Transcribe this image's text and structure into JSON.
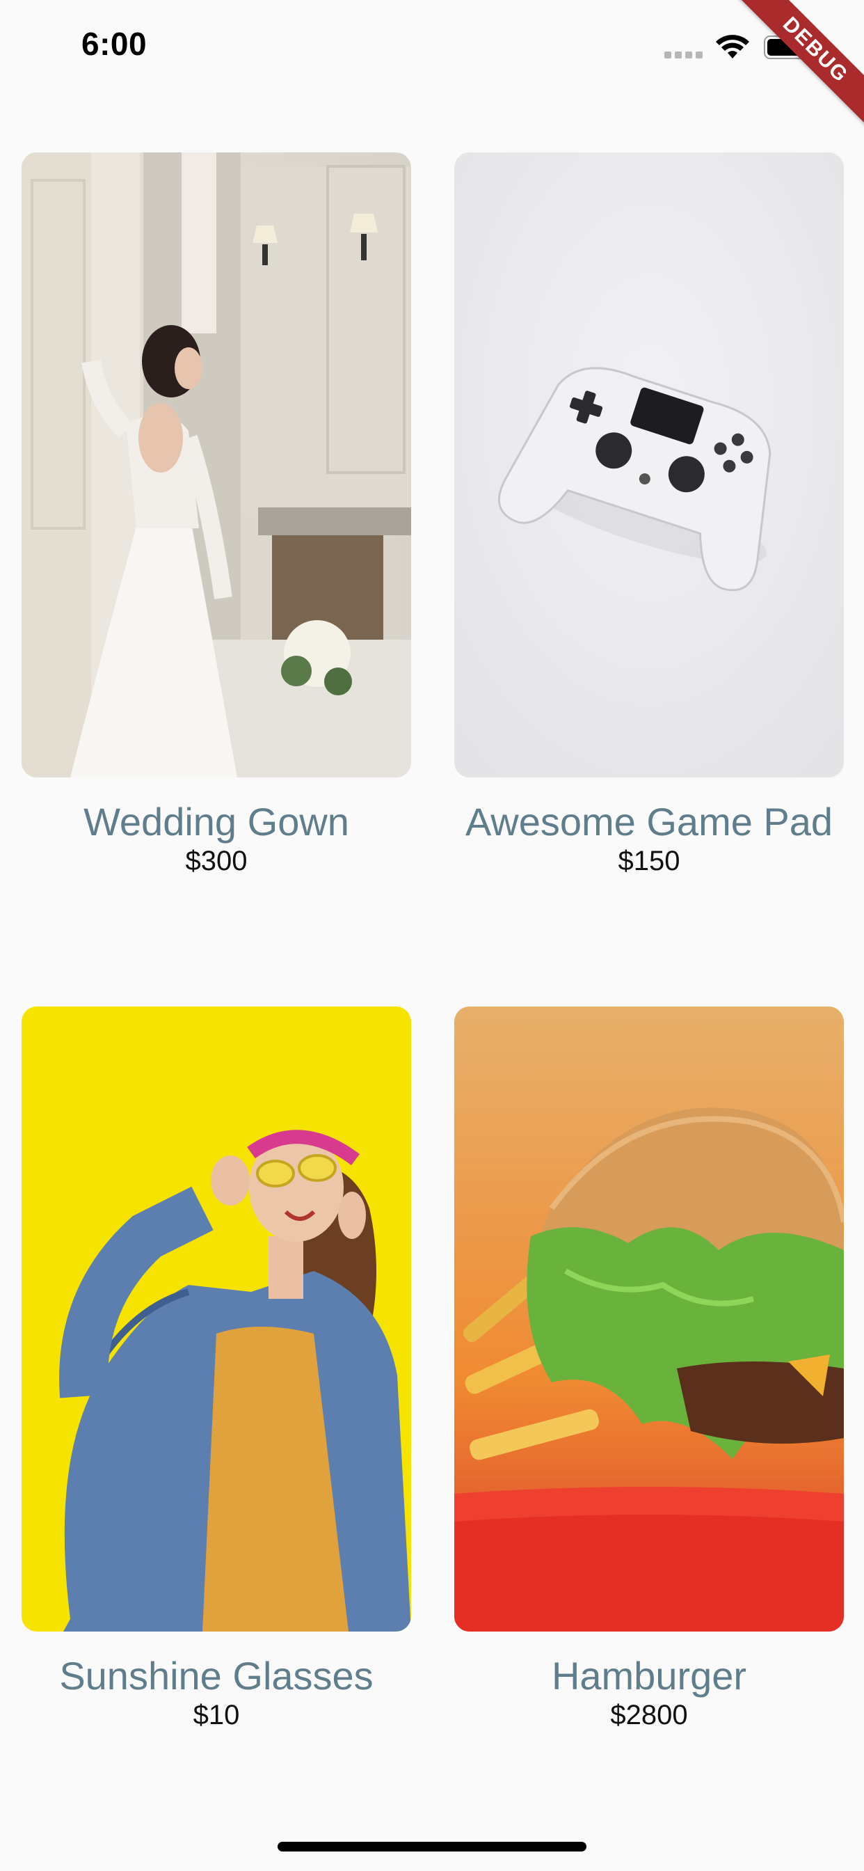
{
  "status_bar": {
    "time": "6:00",
    "icons": [
      "cellular-signal-icon",
      "wifi-icon",
      "battery-icon"
    ]
  },
  "debug_banner": "DEBUG",
  "products": [
    {
      "title": "Wedding Gown",
      "price": "$300",
      "image": "wedding-gown-photo"
    },
    {
      "title": "Awesome Game Pad",
      "price": "$150",
      "image": "game-pad-photo"
    },
    {
      "title": "Sunshine Glasses",
      "price": "$10",
      "image": "sunshine-glasses-photo"
    },
    {
      "title": "Hamburger",
      "price": "$2800",
      "image": "hamburger-photo"
    }
  ],
  "colors": {
    "background": "#fafafa",
    "title": "#607d8b",
    "price": "#111111",
    "debug_banner": "#a92b2b"
  }
}
